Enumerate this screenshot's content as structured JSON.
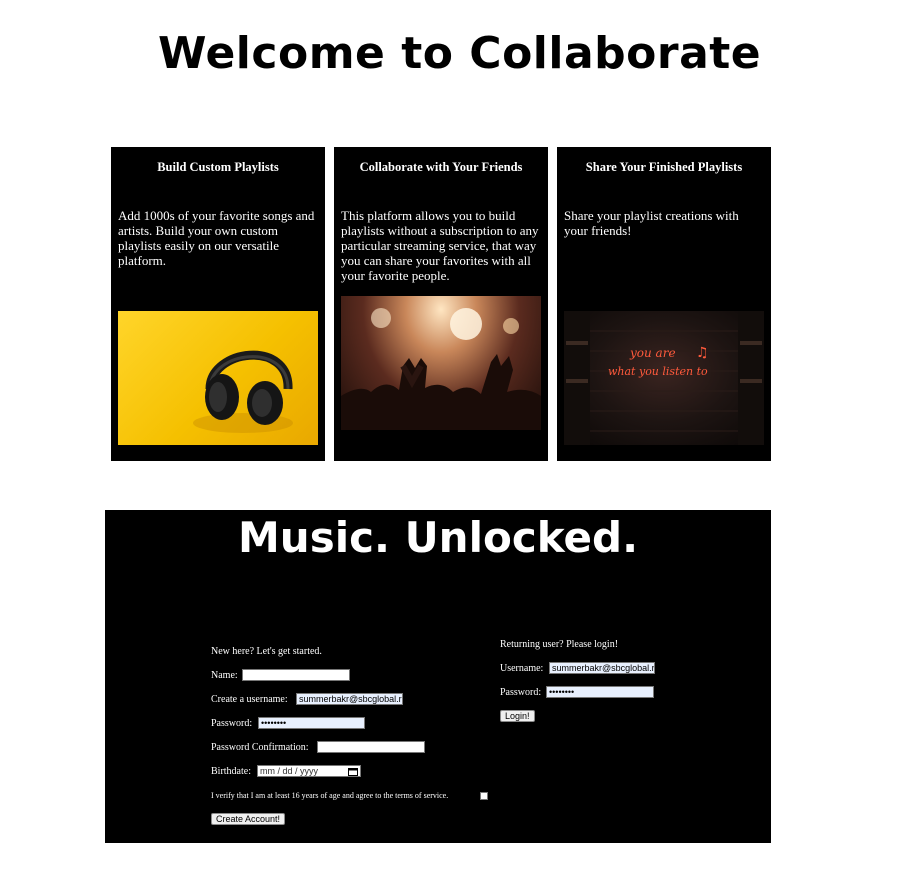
{
  "page": {
    "title": "Welcome to Collaborate"
  },
  "features": [
    {
      "title": "Build Custom Playlists",
      "text": "Add 1000s of your favorite songs and artists. Build your own custom playlists easily on our versatile platform.",
      "image": "headphones-photo"
    },
    {
      "title": "Collaborate with Your Friends",
      "text": "This platform allows you to build playlists without a subscription to any particular streaming service, that way you can share your favorites with all your favorite people.",
      "image": "concert-crowd-photo"
    },
    {
      "title": "Share Your Finished Playlists",
      "text": "Share your playlist creations with your friends!",
      "image": "neon-sign-photo"
    }
  ],
  "panel": {
    "heading": "Music. Unlocked.",
    "neon_text": [
      "you are",
      "what you listen to"
    ]
  },
  "signup": {
    "intro": "New here? Let's get started.",
    "name_label": "Name:",
    "name_value": "",
    "username_label": "Create a username:",
    "username_value": "summerbakr@sbcglobal.r",
    "password_label": "Password:",
    "password_value": "••••••••",
    "confirm_label": "Password Confirmation:",
    "confirm_value": "",
    "birthdate_label": "Birthdate:",
    "birthdate_placeholder": "mm / dd / yyyy",
    "terms_label": "I verify that I am at least 16 years of age and agree to the terms of service.",
    "terms_checked": false,
    "submit_label": "Create Account!"
  },
  "login": {
    "intro": "Returning user? Please login!",
    "username_label": "Username:",
    "username_value": "summerbakr@sbcglobal.r",
    "password_label": "Password:",
    "password_value": "••••••••",
    "submit_label": "Login!"
  },
  "colors": {
    "background": "#ffffff",
    "panel": "#000000",
    "autofill": "#e8f0fe",
    "accent_yellow": "#f5c000",
    "neon": "#ff5a3c"
  }
}
